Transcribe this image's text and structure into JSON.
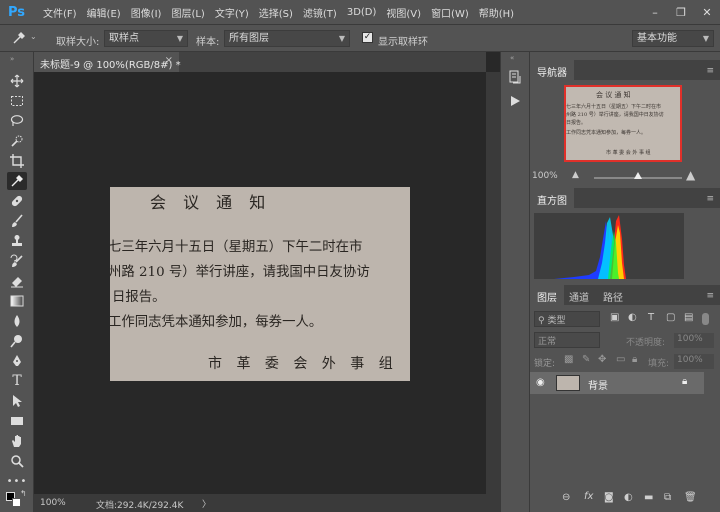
{
  "app": {
    "logo": "Ps",
    "menu": [
      "文件(F)",
      "编辑(E)",
      "图像(I)",
      "图层(L)",
      "文字(Y)",
      "选择(S)",
      "滤镜(T)",
      "3D(D)",
      "视图(V)",
      "窗口(W)",
      "帮助(H)"
    ],
    "window_controls": {
      "minimize": "–",
      "restore": "❐",
      "close": "✕"
    }
  },
  "options_bar": {
    "tool_icon": "eyedropper-icon",
    "sample_size_label": "取样大小:",
    "sample_size_value": "取样点",
    "sample_label": "样本:",
    "sample_value": "所有图层",
    "show_ring_label": "显示取样环",
    "show_ring_checked": true,
    "workspace_value": "基本功能"
  },
  "toolbar": {
    "tools": [
      "move-icon",
      "marquee-icon",
      "lasso-icon",
      "quick-select-icon",
      "crop-icon",
      "eyedropper-icon",
      "healing-icon",
      "brush-icon",
      "clone-stamp-icon",
      "history-brush-icon",
      "eraser-icon",
      "gradient-icon",
      "blur-icon",
      "dodge-icon",
      "pen-icon",
      "type-icon",
      "path-select-icon",
      "rectangle-icon",
      "hand-icon",
      "zoom-icon",
      "more-icon"
    ],
    "active": "eyedropper-icon",
    "type_glyph": "T"
  },
  "document": {
    "tab_title": "未标题-9 @ 100%(RGB/8#) *",
    "tab_close": "×",
    "image_text": {
      "title": "会 议 通 知",
      "line1": "七三年六月十五日（星期五）下午二时在市",
      "line2": "州路 210 号）举行讲座，请我国中日友协访",
      "line3": "日报告。",
      "line4": "工作同志凭本通知参加，每券一人。",
      "signature": "市 革 委 会 外 事 组"
    }
  },
  "statusbar": {
    "zoom": "100%",
    "doc_info": "文档:292.4K/292.4K",
    "arrow": "〉"
  },
  "panels": {
    "navigator": {
      "tab": "导航器",
      "zoom": "100%"
    },
    "histogram": {
      "tab": "直方图"
    },
    "layers": {
      "tabs": [
        "图层",
        "通道",
        "路径"
      ],
      "filter_kind": "类型",
      "blend_mode": "正常",
      "opacity_label": "不透明度:",
      "opacity_value": "100%",
      "lock_label": "锁定:",
      "fill_label": "填充:",
      "fill_value": "100%",
      "layer_name": "背景",
      "filter_letter": "T"
    }
  },
  "colors": {
    "accent_red": "#e0302a",
    "ps_blue": "#31a8ff",
    "panel_bg": "#535353",
    "canvas_bg": "#282828"
  }
}
